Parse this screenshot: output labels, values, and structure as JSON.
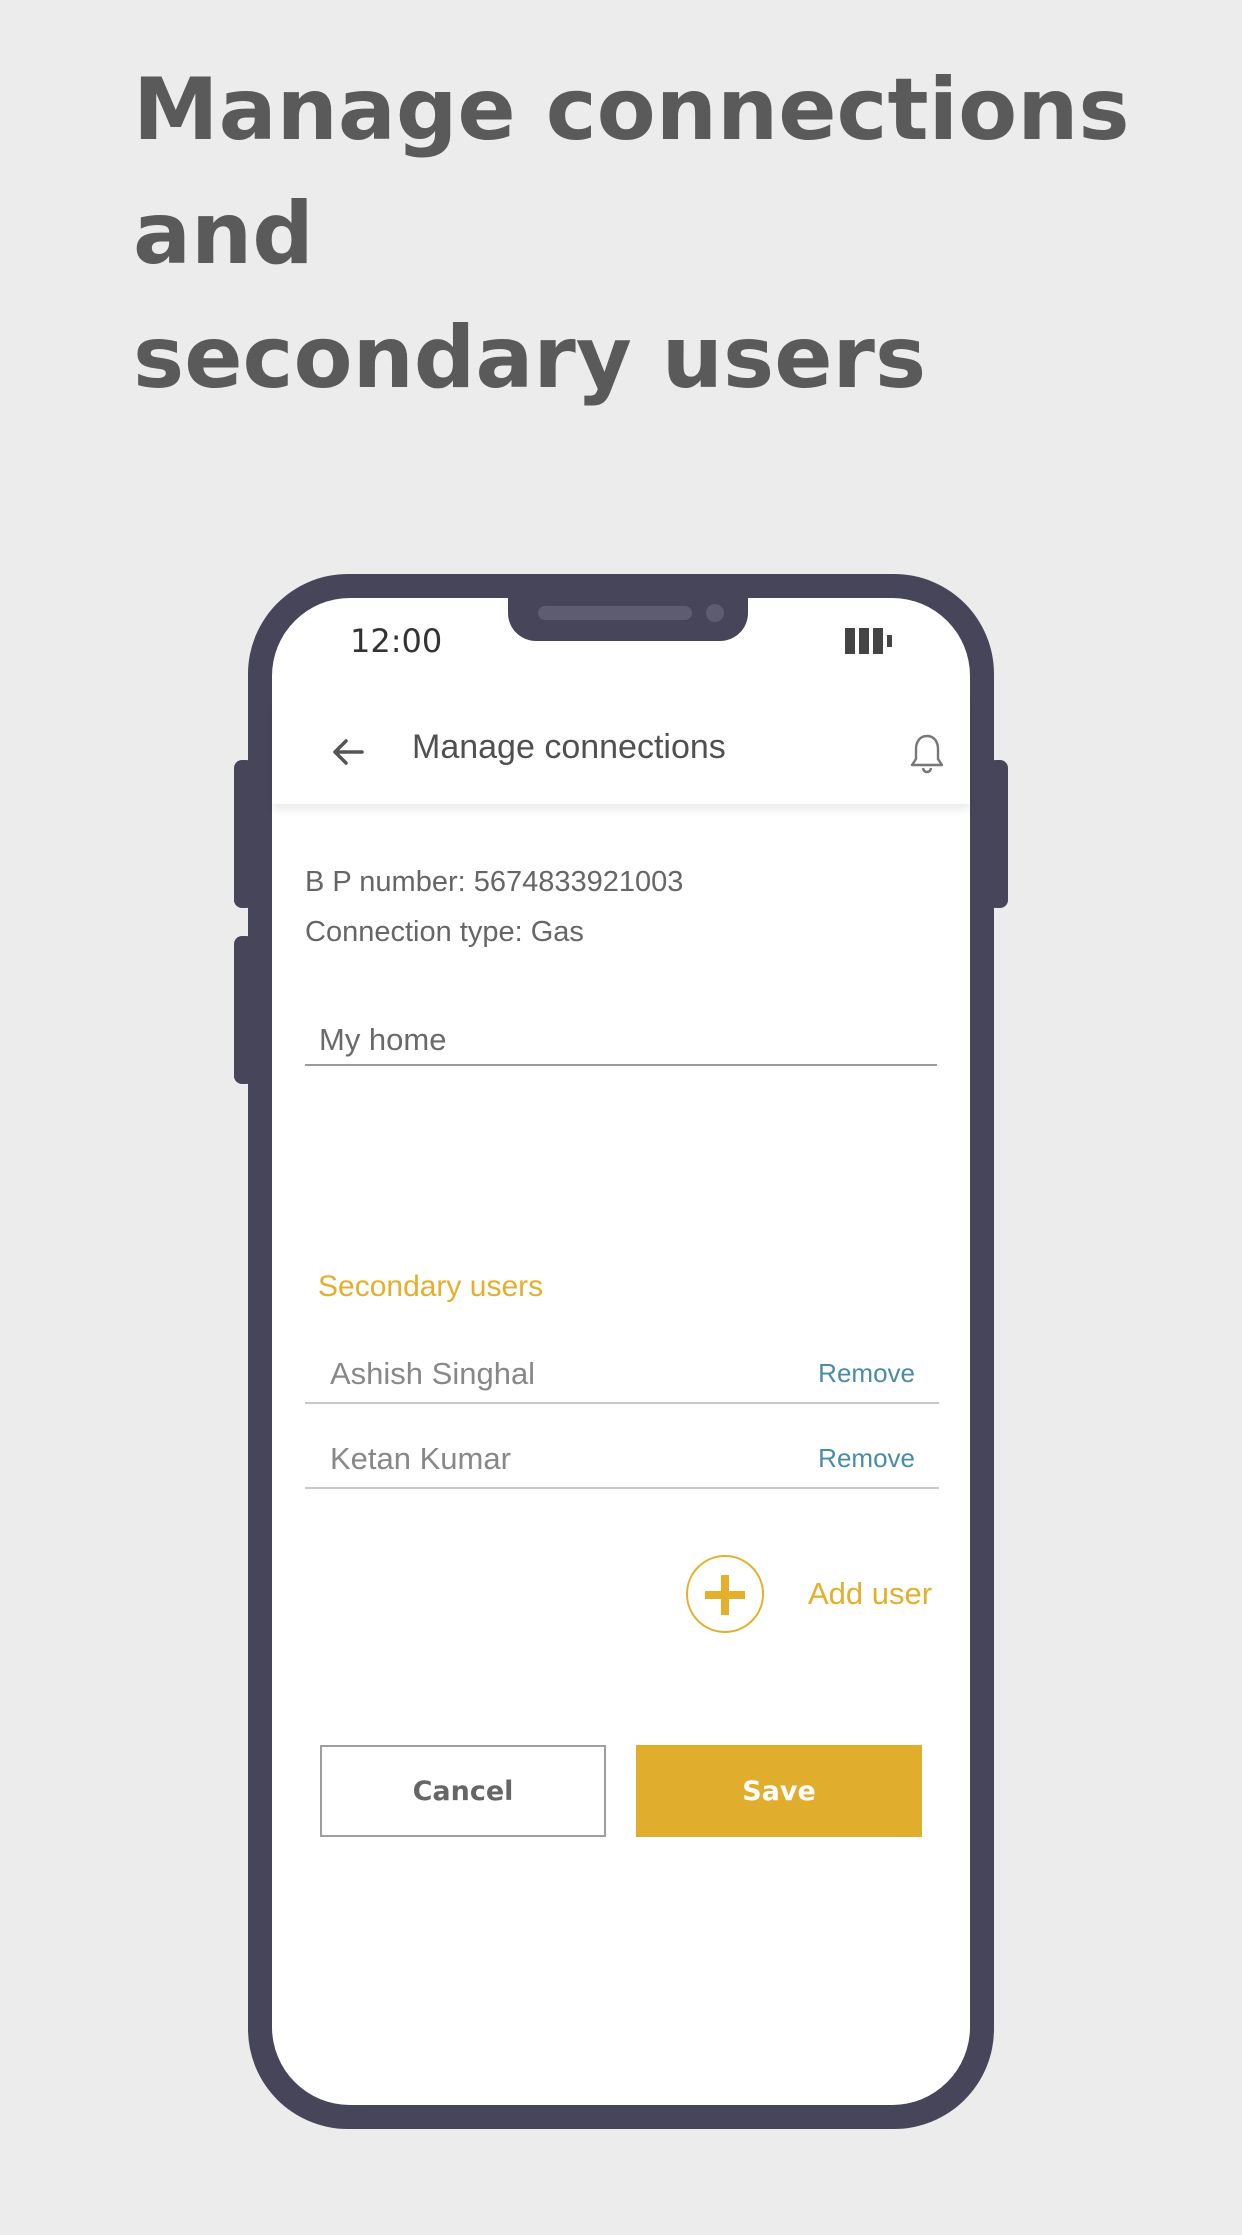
{
  "headline": {
    "line1": "Manage connections and",
    "line2": "secondary users"
  },
  "status_bar": {
    "time": "12:00"
  },
  "app_bar": {
    "title": "Manage connections",
    "back_icon": "arrow-left-icon",
    "notification_icon": "bell-icon"
  },
  "connection": {
    "bp_label": "B P number:",
    "bp_number": "5674833921003",
    "type_label": "Connection type:",
    "type_value": "Gas",
    "nickname_value": "My home"
  },
  "secondary_users": {
    "title": "Secondary users",
    "users": [
      {
        "name": "Ashish Singhal",
        "action": "Remove"
      },
      {
        "name": "Ketan Kumar",
        "action": "Remove"
      }
    ],
    "add_label": "Add user"
  },
  "actions": {
    "cancel_label": "Cancel",
    "save_label": "Save"
  },
  "colors": {
    "accent": "#e0ad2c",
    "link": "#4a8ca8",
    "device": "#474559",
    "background": "#ececec"
  }
}
